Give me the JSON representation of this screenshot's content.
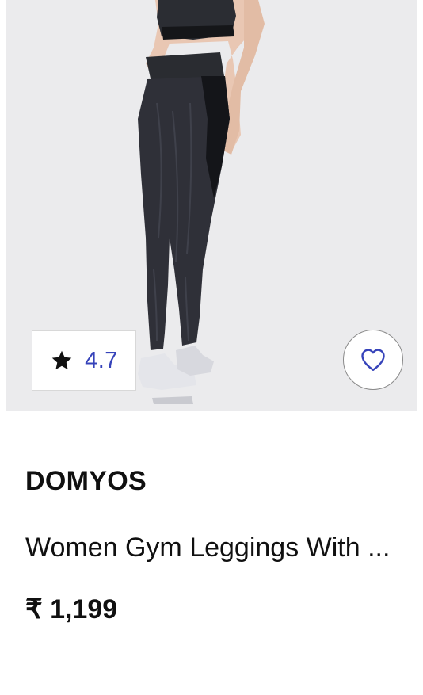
{
  "product": {
    "image_icon": "leggings-product-photo",
    "rating": {
      "icon": "star-icon",
      "value": "4.7"
    },
    "wishlist": {
      "icon": "heart-icon"
    },
    "brand": "DOMYOS",
    "name": "Women Gym Leggings With ...",
    "price": "₹ 1,199"
  },
  "colors": {
    "image_background": "#ebebed",
    "rating_text": "#3643ba",
    "wishlist_heart": "#3643ba",
    "text_primary": "#101010"
  }
}
